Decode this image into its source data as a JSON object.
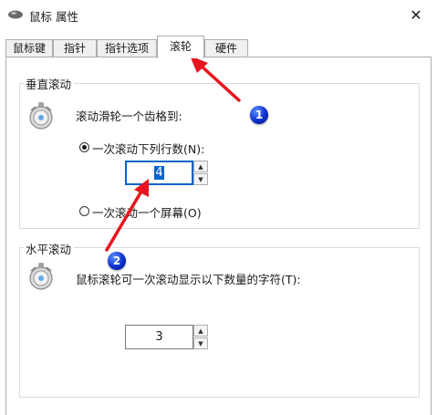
{
  "window": {
    "title": "鼠标 属性",
    "close_glyph": "✕"
  },
  "tabs": [
    {
      "label": "鼠标键"
    },
    {
      "label": "指针"
    },
    {
      "label": "指针选项"
    },
    {
      "label": "滚轮",
      "active": true
    },
    {
      "label": "硬件"
    }
  ],
  "vertical": {
    "title": "垂直滚动",
    "description": "滚动滑轮一个齿格到:",
    "option_lines": {
      "label": "一次滚动下列行数(N):",
      "checked": true
    },
    "lines_value": "4",
    "option_screen": {
      "label": "一次滚动一个屏幕(O)",
      "checked": false
    }
  },
  "horizontal": {
    "title": "水平滚动",
    "description": "鼠标滚轮可一次滚动显示以下数量的字符(T):",
    "chars_value": "3"
  },
  "annotations": {
    "badge_1": "1",
    "badge_2": "2",
    "arrow_color": "#e8141e"
  },
  "icons": [
    "mouse-icon",
    "wheel-icon",
    "close-icon",
    "arrow-up-icon",
    "arrow-down-icon"
  ]
}
